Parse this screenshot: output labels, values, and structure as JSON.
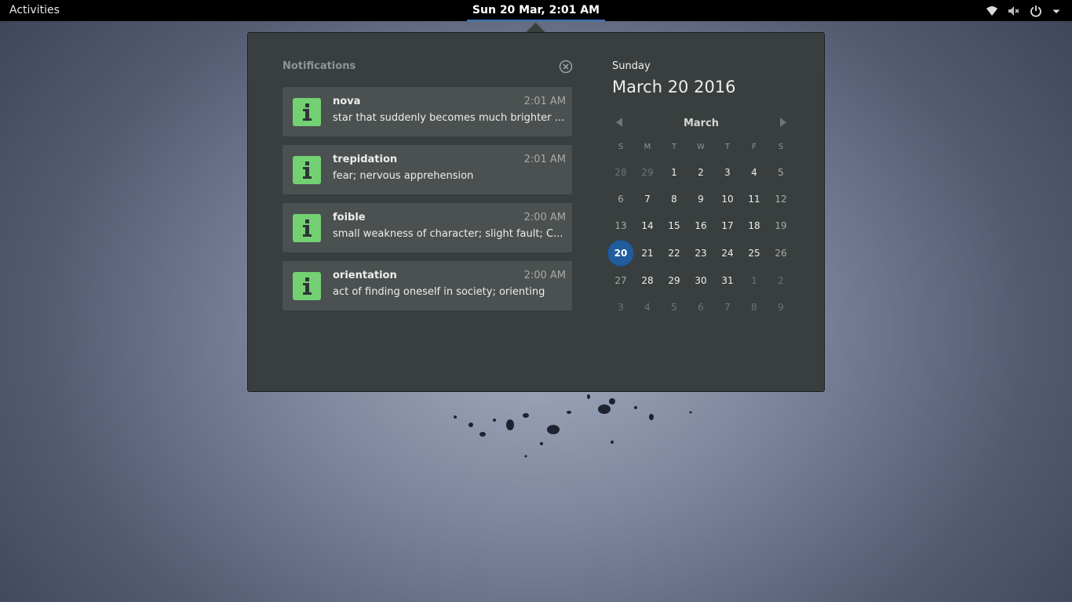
{
  "topbar": {
    "activities_label": "Activities",
    "clock_label": "Sun 20 Mar,  2:01 AM",
    "tray_icons": [
      "wifi-icon",
      "volume-muted-icon",
      "power-icon",
      "dropdown-arrow-icon"
    ]
  },
  "notifications": {
    "header": "Notifications",
    "items": [
      {
        "title": "nova",
        "time": "2:01 AM",
        "body": "star that suddenly becomes much brighter a...",
        "icon": "info-icon"
      },
      {
        "title": "trepidation",
        "time": "2:01 AM",
        "body": "fear; nervous apprehension",
        "icon": "info-icon"
      },
      {
        "title": "foible",
        "time": "2:00 AM",
        "body": "small weakness of character; slight fault; C...",
        "icon": "info-icon"
      },
      {
        "title": "orientation",
        "time": "2:00 AM",
        "body": "act of finding oneself in society; orienting",
        "icon": "info-icon"
      }
    ]
  },
  "calendar": {
    "day_name": "Sunday",
    "full_date": "March 20 2016",
    "month": "March",
    "weekdays": [
      "S",
      "M",
      "T",
      "W",
      "T",
      "F",
      "S"
    ],
    "weeks": [
      [
        "28",
        "29",
        "1",
        "2",
        "3",
        "4",
        "5"
      ],
      [
        "6",
        "7",
        "8",
        "9",
        "10",
        "11",
        "12"
      ],
      [
        "13",
        "14",
        "15",
        "16",
        "17",
        "18",
        "19"
      ],
      [
        "20",
        "21",
        "22",
        "23",
        "24",
        "25",
        "26"
      ],
      [
        "27",
        "28",
        "29",
        "30",
        "31",
        "1",
        "2"
      ],
      [
        "3",
        "4",
        "5",
        "6",
        "7",
        "8",
        "9"
      ]
    ],
    "other_month_cells": [
      [
        0,
        0
      ],
      [
        0,
        1
      ],
      [
        4,
        5
      ],
      [
        4,
        6
      ],
      [
        5,
        0
      ],
      [
        5,
        1
      ],
      [
        5,
        2
      ],
      [
        5,
        3
      ],
      [
        5,
        4
      ],
      [
        5,
        5
      ],
      [
        5,
        6
      ]
    ],
    "today_cell": [
      3,
      0
    ],
    "today_color": "#215d9c"
  },
  "colors": {
    "panel_bg": "#393f3f",
    "notif_bg": "#4b5050",
    "info_icon_bg": "#73d073",
    "clock_underline": "#3b72b8"
  }
}
